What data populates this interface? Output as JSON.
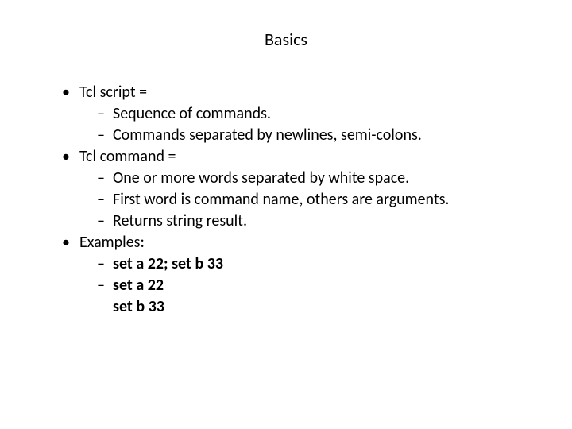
{
  "title": "Basics",
  "b1": {
    "head": "Tcl script =",
    "s1": "Sequence of commands.",
    "s2": "Commands separated by newlines, semi-colons."
  },
  "b2": {
    "head": "Tcl command =",
    "s1": "One or more words separated by white space.",
    "s2": "First word is command name, others are arguments.",
    "s3": "Returns string result."
  },
  "b3": {
    "head": "Examples:",
    "s1": "set a 22; set b 33",
    "s2a": "set a 22",
    "s2b": "set b 33"
  }
}
